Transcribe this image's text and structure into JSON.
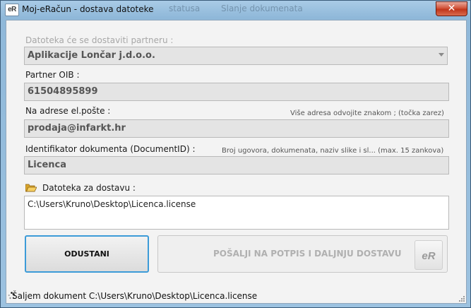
{
  "window": {
    "title": "Moj-eRačun - dostava datoteke",
    "app_icon_text": "eR",
    "close_glyph": "✕"
  },
  "background_titles": [
    "statusa",
    "Slanje dokumenata"
  ],
  "form": {
    "partner_label": "Datoteka će se dostaviti partneru :",
    "partner_value": "Aplikacije Lončar j.d.o.o.",
    "oib_label": "Partner OIB :",
    "oib_value": "61504895899",
    "email_label": "Na adrese el.pošte :",
    "email_hint": "Više adresa odvojite znakom ; (točka zarez)",
    "email_value": "prodaja@infarkt.hr",
    "docid_label": "Identifikator dokumenta (DocumentID) :",
    "docid_hint": "Broj ugovora, dokumenata, naziv slike i sl...  (max. 15 zankova)",
    "docid_value": "Licenca",
    "file_label": "Datoteka za dostavu :",
    "file_value": "C:\\Users\\Kruno\\Desktop\\Licenca.license"
  },
  "buttons": {
    "cancel": "ODUSTANI",
    "send": "POŠALJI NA POTPIS I DALJNJU DOSTAVU",
    "send_badge": "eR"
  },
  "status": {
    "text": "Šaljem dokument C:\\Users\\Kruno\\Desktop\\Licenca.license"
  },
  "colors": {
    "title_bar": "#8fb8d9",
    "close_button": "#c0361b",
    "focus_border": "#3c9bd8"
  },
  "icons": [
    "app-logo-icon",
    "close-icon",
    "chevron-down-icon",
    "folder-open-icon",
    "spinner-icon",
    "resize-grip-icon"
  ]
}
